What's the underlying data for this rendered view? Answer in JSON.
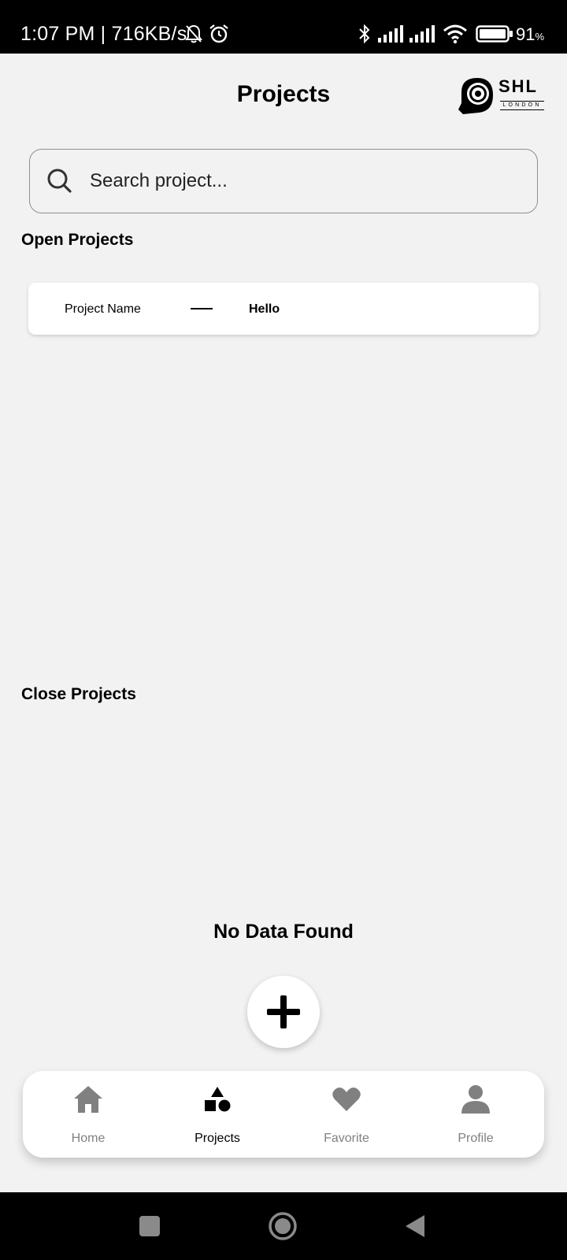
{
  "status_bar": {
    "time": "1:07 PM | 716KB/s",
    "battery_percent": "91",
    "battery_unit": "%",
    "icons": [
      "bell-off-icon",
      "alarm-icon",
      "bluetooth-icon",
      "signal-icon",
      "signal-icon",
      "wifi-icon",
      "battery-icon"
    ]
  },
  "header": {
    "title": "Projects",
    "logo_text": "SHL",
    "logo_subtext": "LONDON"
  },
  "search": {
    "placeholder": "Search project..."
  },
  "open_projects": {
    "title": "Open Projects",
    "items": [
      {
        "label": "Project Name",
        "value": "Hello"
      }
    ]
  },
  "close_projects": {
    "title": "Close Projects",
    "empty_text": "No Data Found"
  },
  "fab": {
    "icon": "plus-icon"
  },
  "bottom_nav": {
    "items": [
      {
        "label": "Home",
        "icon": "home-icon",
        "active": false
      },
      {
        "label": "Projects",
        "icon": "shapes-icon",
        "active": true
      },
      {
        "label": "Favorite",
        "icon": "heart-icon",
        "active": false
      },
      {
        "label": "Profile",
        "icon": "person-icon",
        "active": false
      }
    ]
  },
  "colors": {
    "background": "#f2f2f2",
    "card": "#ffffff",
    "inactive_nav": "#808080",
    "active_nav": "#000000"
  }
}
